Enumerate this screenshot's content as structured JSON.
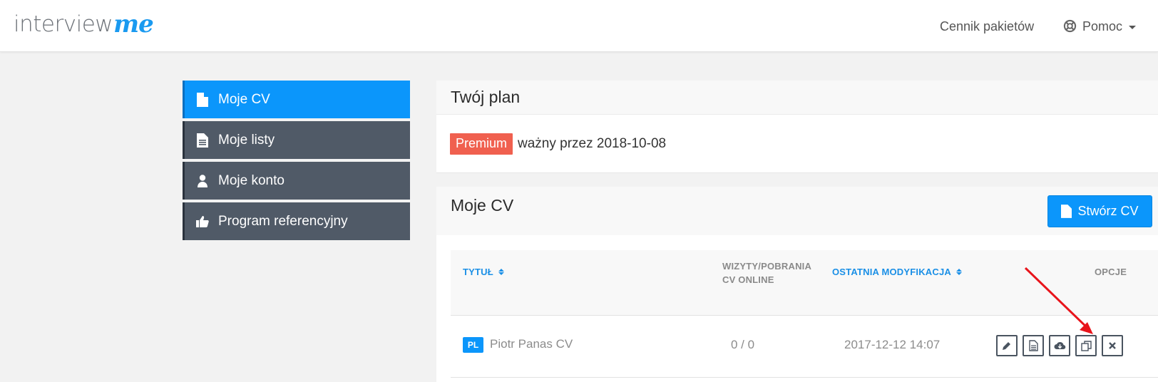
{
  "header": {
    "logo_main": "interview",
    "logo_script": "me",
    "nav_pricing": "Cennik pakietów",
    "nav_help": "Pomoc"
  },
  "sidebar": {
    "items": [
      {
        "label": "Moje CV",
        "icon": "file-icon",
        "active": true
      },
      {
        "label": "Moje listy",
        "icon": "file-text-icon",
        "active": false
      },
      {
        "label": "Moje konto",
        "icon": "user-icon",
        "active": false
      },
      {
        "label": "Program referencyjny",
        "icon": "thumbs-up-icon",
        "active": false
      }
    ]
  },
  "plan": {
    "title": "Twój plan",
    "badge": "Premium",
    "valid_text": "ważny przez 2018-10-08"
  },
  "cv_panel": {
    "title": "Moje CV",
    "create_label": "Stwórz CV",
    "columns": {
      "title": "TYTUŁ",
      "visits_line1": "WIZYTY/POBRANIA",
      "visits_line2": "CV ONLINE",
      "modified": "OSTATNIA MODYFIKACJA",
      "options": "OPCJE"
    },
    "rows": [
      {
        "lang": "PL",
        "title": "Piotr Panas CV",
        "visits": "0 / 0",
        "modified": "2017-12-12 14:07",
        "actions": [
          "edit-icon",
          "preview-icon",
          "download-icon",
          "duplicate-icon",
          "delete-icon"
        ]
      }
    ]
  },
  "colors": {
    "accent": "#0b96fb",
    "sidebar": "#505a67",
    "premium": "#f0604f",
    "annotation_arrow": "#e8141b"
  }
}
